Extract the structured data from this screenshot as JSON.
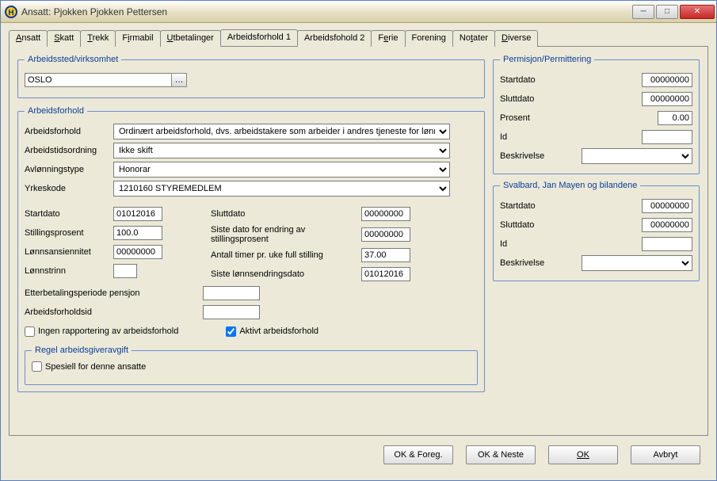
{
  "window": {
    "title": "Ansatt: Pjokken Pjokken Pettersen"
  },
  "tabs": [
    {
      "label": "Ansatt",
      "accel": "A"
    },
    {
      "label": "Skatt",
      "accel": "S"
    },
    {
      "label": "Trekk",
      "accel": "T"
    },
    {
      "label": "Firmabil",
      "accel": "i"
    },
    {
      "label": "Utbetalinger",
      "accel": "U"
    },
    {
      "label": "Arbeidsforhold 1",
      "active": true
    },
    {
      "label": "Arbeidsfohold 2"
    },
    {
      "label": "Ferie",
      "accel": "e"
    },
    {
      "label": "Forening"
    },
    {
      "label": "Notater",
      "accel": "t"
    },
    {
      "label": "Diverse",
      "accel": "D"
    }
  ],
  "arbeidssted": {
    "legend": "Arbeidssted/virksomhet",
    "value": "OSLO"
  },
  "arbeidsforhold": {
    "legend": "Arbeidsforhold",
    "fields": {
      "arbeidsforhold_label": "Arbeidsforhold",
      "arbeidsforhold_value": "Ordinært arbeidsforhold, dvs. arbeidstakere som arbeider i andres tjeneste for lønn eller a",
      "arbeidstidsordning_label": "Arbeidstidsordning",
      "arbeidstidsordning_value": "Ikke skift",
      "avlonningstype_label": "Avlønningstype",
      "avlonningstype_value": "Honorar",
      "yrkeskode_label": "Yrkeskode",
      "yrkeskode_value": "1210160 STYREMEDLEM",
      "startdato_label": "Startdato",
      "startdato_value": "01012016",
      "stillingsprosent_label": "Stillingsprosent",
      "stillingsprosent_value": "100.0",
      "lonnsansiennitet_label": "Lønnsansiennitet",
      "lonnsansiennitet_value": "00000000",
      "lonnstrinn_label": "Lønnstrinn",
      "lonnstrinn_value": "",
      "sluttdato_label": "Sluttdato",
      "sluttdato_value": "00000000",
      "siste_endring_label": "Siste dato for endring av stillingsprosent",
      "siste_endring_value": "00000000",
      "antall_timer_label": "Antall timer pr. uke full stilling",
      "antall_timer_value": "37.00",
      "siste_lonnsendring_label": "Siste lønnsendringsdato",
      "siste_lonnsendring_value": "01012016",
      "etterbetaling_label": "Etterbetalingsperiode pensjon",
      "etterbetaling_value": "",
      "arbeidsforholdsid_label": "Arbeidsforholdsid",
      "arbeidsforholdsid_value": "",
      "ingen_rapportering_label": "Ingen rapportering av arbeidsforhold",
      "ingen_rapportering_checked": false,
      "aktivt_label": "Aktivt arbeidsforhold",
      "aktivt_checked": true
    },
    "regel": {
      "legend": "Regel arbeidsgiveravgift",
      "spesiell_label": "Spesiell for denne ansatte",
      "spesiell_checked": false
    }
  },
  "permisjon": {
    "legend": "Permisjon/Permittering",
    "startdato_label": "Startdato",
    "startdato_value": "00000000",
    "sluttdato_label": "Sluttdato",
    "sluttdato_value": "00000000",
    "prosent_label": "Prosent",
    "prosent_value": "0.00",
    "id_label": "Id",
    "id_value": "",
    "beskrivelse_label": "Beskrivelse",
    "beskrivelse_value": ""
  },
  "svalbard": {
    "legend": "Svalbard, Jan Mayen og bilandene",
    "startdato_label": "Startdato",
    "startdato_value": "00000000",
    "sluttdato_label": "Sluttdato",
    "sluttdato_value": "00000000",
    "id_label": "Id",
    "id_value": "",
    "beskrivelse_label": "Beskrivelse",
    "beskrivelse_value": ""
  },
  "buttons": {
    "ok_foreg": "OK & Foreg.",
    "ok_neste": "OK & Neste",
    "ok": "OK",
    "avbryt": "Avbryt"
  }
}
